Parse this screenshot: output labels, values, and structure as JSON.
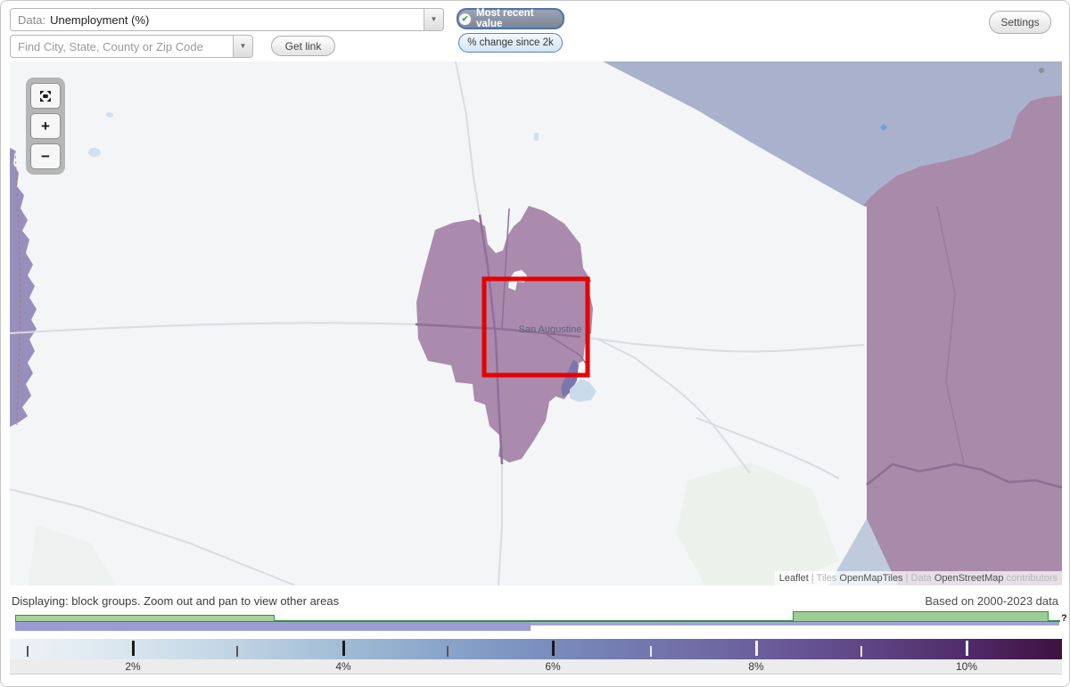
{
  "header": {
    "data_label": "Data:",
    "data_value": "Unemployment (%)",
    "dropdown_arrow": "▼",
    "search_placeholder": "Find City, State, County or Zip Code",
    "get_link_label": "Get link",
    "most_recent_label": "Most recent value",
    "most_recent_check": "✔",
    "pct_change_label": "% change since 2k",
    "settings_label": "Settings"
  },
  "map": {
    "place_label": "San Augustine",
    "zoom_in_label": "+",
    "zoom_out_label": "−",
    "attribution": {
      "leaflet": "Leaflet",
      "sep1": " | Tiles ",
      "tiles": "OpenMapTiles",
      "sep2": " | Data ",
      "data": "OpenStreetMap",
      "suffix": " contributors"
    },
    "region_colors": {
      "background": "#f3f5f6",
      "town_mauve": "#aa8aad",
      "east_mauve": "#a88aab",
      "northeast_blue": "#a9b1cd",
      "west_strip_violet": "#998fbc",
      "lake_blue": "#c9dbeb",
      "dark_patch": "#7d76ae",
      "light_triangle": "#bfcbdc",
      "highlight_rect": "#e60000"
    }
  },
  "status": {
    "displaying": "Displaying: block groups. Zoom out and pan to view other areas",
    "based_on": "Based on 2000-2023 data"
  },
  "availability": {
    "green_fill": "#a6d39a",
    "green_border": "#2f9637",
    "purple_fill": "#999bd2",
    "help_label": "?"
  },
  "legend": {
    "labels": [
      {
        "text": "2%"
      },
      {
        "text": "4%"
      },
      {
        "text": "6%"
      },
      {
        "text": "8%"
      },
      {
        "text": "10%"
      }
    ],
    "scale_min_color": "#eef3f7",
    "scale_max_color": "#3f1243"
  }
}
